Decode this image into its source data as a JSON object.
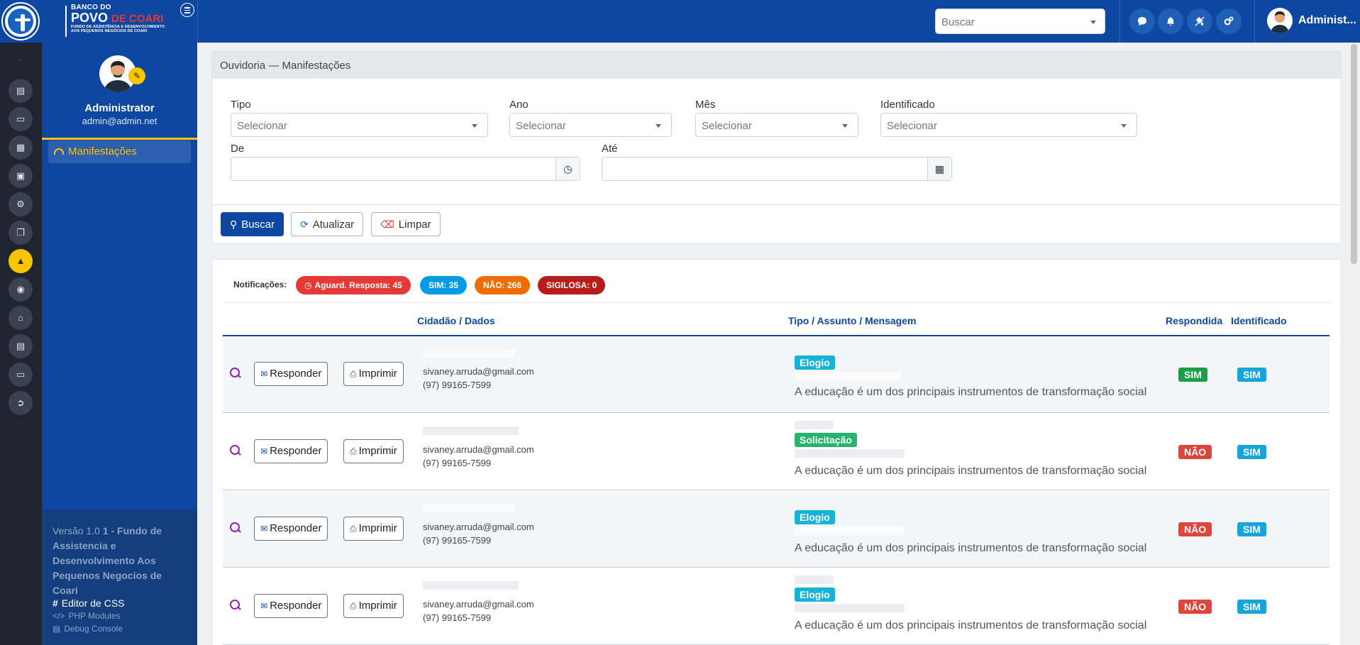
{
  "brand": {
    "line1": "BANCO DO",
    "line2_a": "POVO",
    "line2_b": "DE COARI",
    "line3a": "FUNDO DE ASSISTÊNCIA E DESENVOLVIMENTO",
    "line3b": "AOS PEQUENOS NEGÓCIOS DE COARI"
  },
  "topbar": {
    "search_placeholder": "Buscar",
    "icons": [
      "chat-icon",
      "bell-icon",
      "palette-icon",
      "gears-icon"
    ],
    "user_name": "Administ..."
  },
  "sidebar": {
    "name": "Administrator",
    "email": "admin@admin.net",
    "menu": [
      {
        "label": "Manifestações",
        "icon": "inbox-icon",
        "active": true
      }
    ],
    "version_prefix": "Versão 1.0",
    "version_entity": "1 - Fundo de Assistencia e Desenvolvimento Aos Pequenos Negocios de Coari",
    "link_css": "Editor de CSS",
    "link_php": "PHP Modules",
    "link_debug": "Debug Console"
  },
  "rail": {
    "icons": [
      "id-card-icon",
      "clipboard-icon",
      "calendar-icon",
      "money-icon",
      "gears-icon",
      "copy-icon",
      "megaphone-icon",
      "globe-icon",
      "home-icon",
      "file-icon",
      "monitor-icon",
      "sign-out-icon"
    ],
    "active_index": 6
  },
  "filters": {
    "title": "Ouvidoria — Manifestações",
    "tipo_label": "Tipo",
    "ano_label": "Ano",
    "mes_label": "Mês",
    "identificado_label": "Identificado",
    "de_label": "De",
    "ate_label": "Até",
    "select_placeholder": "Selecionar",
    "btn_buscar": "Buscar",
    "btn_atualizar": "Atualizar",
    "btn_limpar": "Limpar"
  },
  "notifications": {
    "label": "Notificações:",
    "aguard": "Aguard. Resposta: 45",
    "sim": "SIM: 35",
    "nao": "NÃO: 266",
    "sigilosa": "SIGILOSA: 0"
  },
  "table": {
    "col_cidadao": "Cidadão / Dados",
    "col_tipo": "Tipo / Assunto / Mensagem",
    "col_respondida": "Respondida",
    "col_identificado": "Identificado",
    "btn_responder": "Responder",
    "btn_imprimir": "Imprimir",
    "rows": [
      {
        "email": "sivaney.arruda@gmail.com",
        "phone": "(97) 99165-7599",
        "tipo": "Elogio",
        "mensagem": "A educação é um dos principais instrumentos de transformação social",
        "respondida": "SIM",
        "identificado": "SIM"
      },
      {
        "email": "sivaney.arruda@gmail.com",
        "phone": "(97) 99165-7599",
        "tipo": "Solicitação",
        "mensagem": "A educação é um dos principais instrumentos de transformação social",
        "respondida": "NÃO",
        "identificado": "SIM"
      },
      {
        "email": "sivaney.arruda@gmail.com",
        "phone": "(97) 99165-7599",
        "tipo": "Elogio",
        "mensagem": "A educação é um dos principais instrumentos de transformação social",
        "respondida": "NÃO",
        "identificado": "SIM"
      },
      {
        "email": "sivaney.arruda@gmail.com",
        "phone": "(97) 99165-7599",
        "tipo": "Elogio",
        "mensagem": "A educação é um dos principais instrumentos de transformação social",
        "respondida": "NÃO",
        "identificado": "SIM"
      }
    ]
  },
  "colors": {
    "primary": "#0d47a1",
    "accent": "#f9c400",
    "pill_aguard": "#e53935",
    "pill_sim": "#039be5",
    "pill_nao": "#ef6c00",
    "pill_sigilosa": "#b71c1c",
    "badge_elogio": "#17b3d6",
    "badge_solicitacao": "#26b36b",
    "yn_sim_green": "#1a9e47",
    "yn_nao": "#e0443a",
    "yn_sim_blue": "#17a4db"
  }
}
